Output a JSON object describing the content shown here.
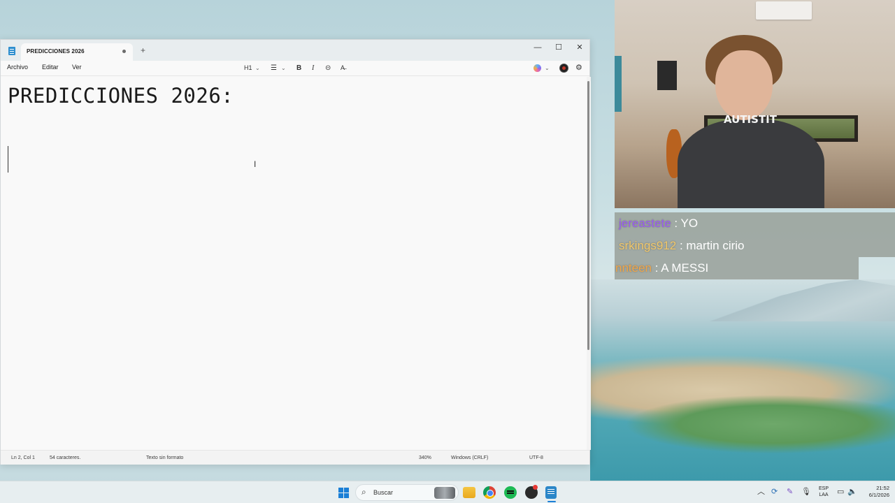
{
  "notepad": {
    "tab_title": "PREDICCIONES 2026",
    "new_tab": "+",
    "window_controls": {
      "minimize": "—",
      "maximize": "☐",
      "close": "✕"
    },
    "menu": {
      "file": "Archivo",
      "edit": "Editar",
      "view": "Ver"
    },
    "toolbar": {
      "heading": "H1",
      "chevron": "⌄",
      "list": "☰",
      "bold": "B",
      "italic": "I",
      "link": "⊝",
      "clear_format": "A̶",
      "settings": "⚙"
    },
    "content": {
      "heading": "PREDICCIONES 2026:",
      "ibeam": "I"
    },
    "status": {
      "position": "Ln 2, Col 1",
      "chars": "54 caracteres.",
      "format": "Texto sin formato",
      "zoom": "340%",
      "line_endings": "Windows (CRLF)",
      "encoding": "UTF-8"
    }
  },
  "webcam": {
    "shirt_print": "AUTISTIT"
  },
  "chat": [
    {
      "user": "jereastete",
      "sep": " : ",
      "message": "YO",
      "color": "#9b5cf0"
    },
    {
      "user": "srkings912",
      "sep": " : ",
      "message": "martin cirio",
      "color": "#f2c86b"
    },
    {
      "user": "nnteen",
      "sep": " : ",
      "message": "A MESSI",
      "color": "#f0a64a"
    }
  ],
  "taskbar": {
    "search_placeholder": "Buscar",
    "search_icon": "⌕",
    "tray": {
      "chevron": "︿",
      "sync": "⟳",
      "pen": "✎",
      "mic": "🎙",
      "lang_top": "ESP",
      "lang_bottom": "LAA",
      "wifi": "▭",
      "volume": "🔈",
      "time": "21:52",
      "date": "6/1/2026"
    }
  }
}
